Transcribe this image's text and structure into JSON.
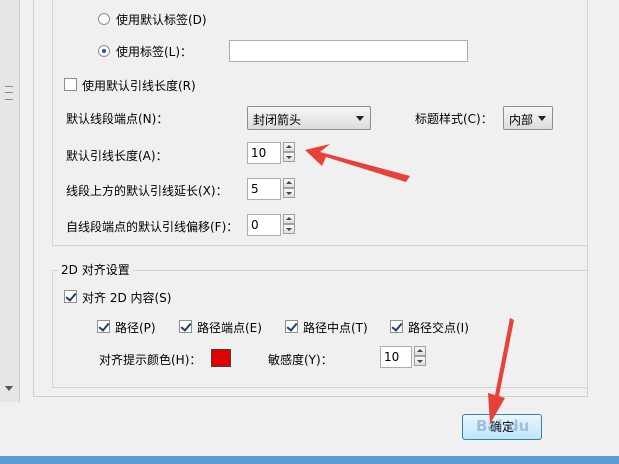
{
  "radio_default_label": "使用默认标签(D)",
  "radio_use_label": "使用标签(L)：",
  "label_text_value": "",
  "check_default_leader_length": "使用默认引线长度(R)",
  "default_endpoint_label": "默认线段端点(N)：",
  "default_endpoint_value": "封闭箭头",
  "title_style_label": "标题样式(C)：",
  "title_style_value": "内部",
  "default_leader_length_label": "默认引线长度(A)：",
  "default_leader_length_value": "10",
  "leader_extension_label": "线段上方的默认引线延长(X)：",
  "leader_extension_value": "5",
  "leader_offset_label": "自线段端点的默认引线偏移(F)：",
  "leader_offset_value": "0",
  "group2d_title": "2D 对齐设置",
  "align_2d_content": "对齐 2D 内容(S)",
  "path_label": "路径(P)",
  "path_endpoint_label": "路径端点(E)",
  "path_midpoint_label": "路径中点(T)",
  "path_intersection_label": "路径交点(I)",
  "align_color_label": "对齐提示颜色(H)：",
  "align_color": "#e00000",
  "sensitivity_label": "敏感度(Y)：",
  "sensitivity_value": "10",
  "ok_label": "确定",
  "watermark_text": "Bai du"
}
